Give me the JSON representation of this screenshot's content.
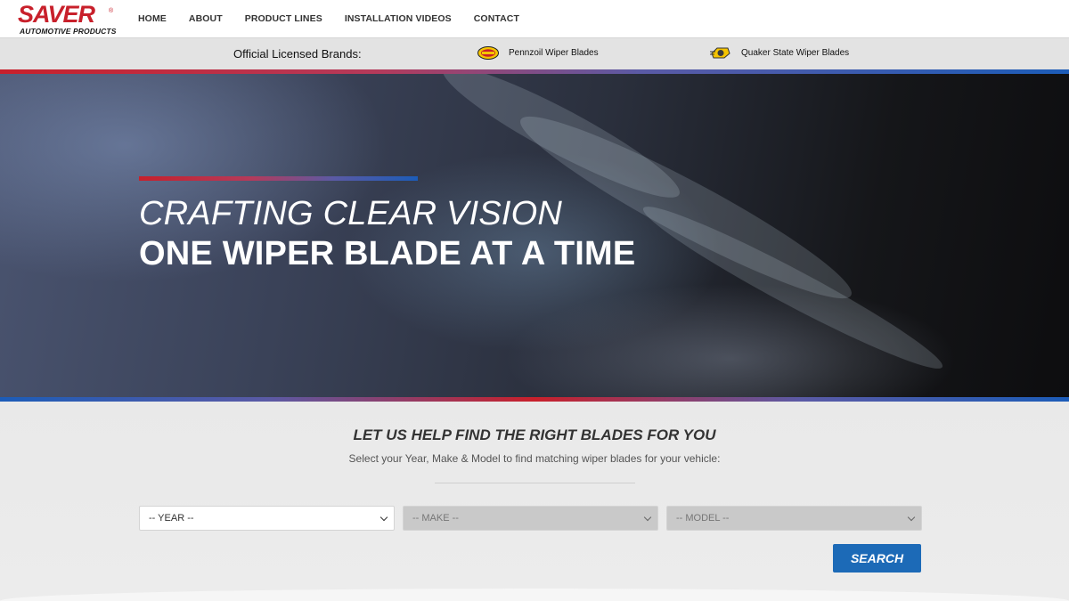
{
  "header": {
    "logo": {
      "brand": "SAVER",
      "registered": "®",
      "tagline": "AUTOMOTIVE PRODUCTS"
    },
    "nav": [
      {
        "label": "HOME"
      },
      {
        "label": "ABOUT"
      },
      {
        "label": "PRODUCT LINES"
      },
      {
        "label": "INSTALLATION VIDEOS"
      },
      {
        "label": "CONTACT"
      }
    ]
  },
  "brands_bar": {
    "title": "Official Licensed Brands:",
    "brands": [
      {
        "label": "Pennzoil Wiper Blades",
        "icon": "pennzoil-logo-icon"
      },
      {
        "label": "Quaker State Wiper Blades",
        "icon": "quaker-state-logo-icon"
      }
    ]
  },
  "hero": {
    "line1": "CRAFTING CLEAR VISION",
    "line2": "ONE WIPER BLADE AT A TIME"
  },
  "finder": {
    "title": "LET US HELP FIND THE RIGHT BLADES FOR YOU",
    "subtitle": "Select your Year, Make & Model to find matching wiper blades for your vehicle:",
    "selects": {
      "year": "-- YEAR --",
      "make": "-- MAKE --",
      "model": "-- MODEL --"
    },
    "search_label": "SEARCH"
  },
  "colors": {
    "brand_red": "#c8202b",
    "brand_blue": "#1c6ab7",
    "bar_gray": "#e3e3e3"
  }
}
